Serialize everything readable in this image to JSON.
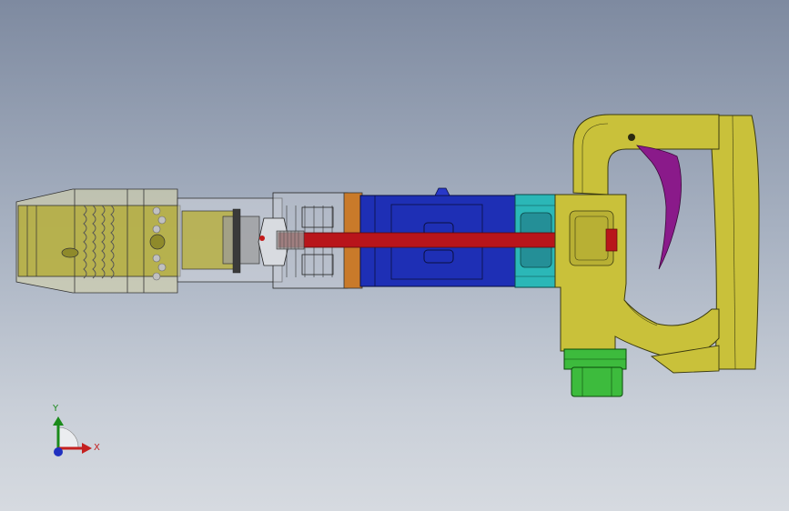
{
  "viewport": {
    "background_top": "#7e8aa0",
    "background_bottom": "#d6dae0"
  },
  "model": {
    "description_parts": [
      "chisel-retainer",
      "spring",
      "barrel",
      "piston-rod",
      "cylinder",
      "valve-ring",
      "handle",
      "trigger",
      "air-inlet-fitting"
    ],
    "colors": {
      "retainer": "#c8c866",
      "barrel": "#b7b04a",
      "cylinder": "#1e2fb5",
      "valve_ring": "#2bb7b7",
      "orange_ring": "#c97a2a",
      "piston_rod": "#b8151b",
      "handle": "#c9c13a",
      "trigger": "#8a1a8a",
      "inlet_fitting": "#3dbb3d"
    }
  },
  "triad": {
    "x_label": "X",
    "y_label": "Y",
    "x_color": "#c42020",
    "y_color": "#1a8a1a",
    "z_color": "#2030c0"
  }
}
